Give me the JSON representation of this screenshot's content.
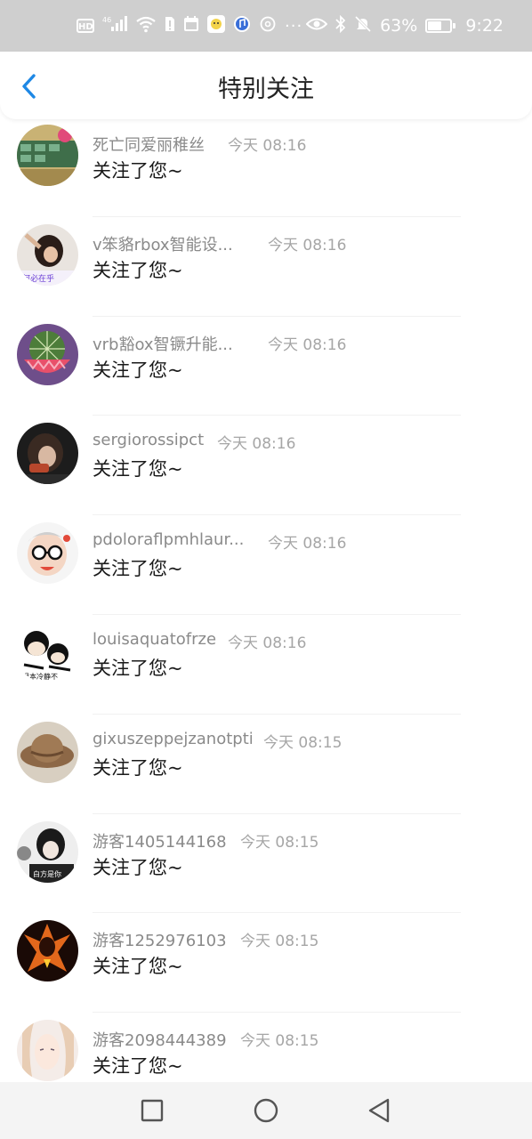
{
  "status_bar": {
    "network": "⁴⁶",
    "battery_text": "63%",
    "battery_level": 0.63,
    "time": "9:22",
    "hd_label": "HD",
    "icons": [
      "hd-icon",
      "signal-icon",
      "wifi-icon",
      "sim-icon",
      "calendar-icon",
      "app-icon",
      "music-app-icon",
      "settings-icon",
      "more-dots",
      "eye-icon",
      "bluetooth-icon",
      "mute-bell-icon",
      "battery-icon"
    ]
  },
  "header": {
    "title": "特别关注",
    "back_icon": "chevron-left-icon"
  },
  "accent_color": "#1E88E5",
  "list": [
    {
      "name": "死亡同爱丽稚丝",
      "time": "今天 08:16",
      "message": "关注了您~"
    },
    {
      "name": "v笨貉rbox智能设...",
      "time": "今天 08:16",
      "message": "关注了您~"
    },
    {
      "name": "vrb豁ox智镢升能...",
      "time": "今天 08:16",
      "message": "关注了您~"
    },
    {
      "name": "sergiorossipct",
      "time": "今天 08:16",
      "message": "关注了您~"
    },
    {
      "name": "pdoloraflpmhlaur...",
      "time": "今天 08:16",
      "message": "关注了您~"
    },
    {
      "name": "louisaquatofrze",
      "time": "今天 08:16",
      "message": "关注了您~"
    },
    {
      "name": "gixuszeppejzanotpti",
      "time": "今天 08:15",
      "message": "关注了您~"
    },
    {
      "name": "游客1405144168",
      "time": "今天 08:15",
      "message": "关注了您~"
    },
    {
      "name": "游客1252976103",
      "time": "今天 08:15",
      "message": "关注了您~"
    },
    {
      "name": "游客2098444389",
      "time": "今天 08:15",
      "message": "关注了您~"
    }
  ],
  "nav_bar": {
    "icons": [
      "recent-apps-icon",
      "home-icon",
      "back-triangle-icon"
    ]
  }
}
